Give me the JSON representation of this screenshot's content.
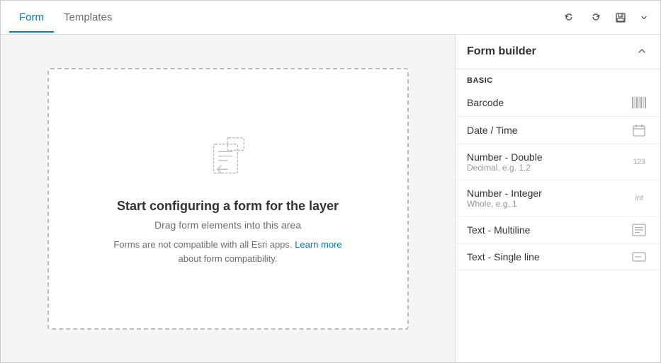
{
  "tabs": [
    {
      "id": "form",
      "label": "Form",
      "active": true
    },
    {
      "id": "templates",
      "label": "Templates",
      "active": false
    }
  ],
  "toolbar": {
    "undo_label": "↺",
    "redo_label": "↻",
    "save_label": "💾",
    "more_label": "▾"
  },
  "dropzone": {
    "title": "Start configuring a form for the layer",
    "subtitle": "Drag form elements into this area",
    "note_before_link": "Forms are not compatible with all Esri apps.",
    "note_link_text": "Learn more",
    "note_after_link": "about form compatibility."
  },
  "right_panel": {
    "title": "Form builder",
    "section_basic": "BASIC",
    "collapse_icon": "▲",
    "elements": [
      {
        "name": "Barcode",
        "desc": "",
        "icon": "barcode"
      },
      {
        "name": "Date / Time",
        "desc": "",
        "icon": "calendar"
      },
      {
        "name": "Number - Double",
        "desc": "Decimal, e.g. 1.2",
        "icon": "123"
      },
      {
        "name": "Number - Integer",
        "desc": "Whole, e.g. 1",
        "icon": "int"
      },
      {
        "name": "Text - Multiline",
        "desc": "",
        "icon": "multiline"
      },
      {
        "name": "Text - Single line",
        "desc": "",
        "icon": "singleline"
      }
    ]
  },
  "icons": {
    "barcode": "▦",
    "calendar": "☐",
    "number": "123",
    "int": "int",
    "multiline": "▤",
    "singleline": "▭"
  }
}
